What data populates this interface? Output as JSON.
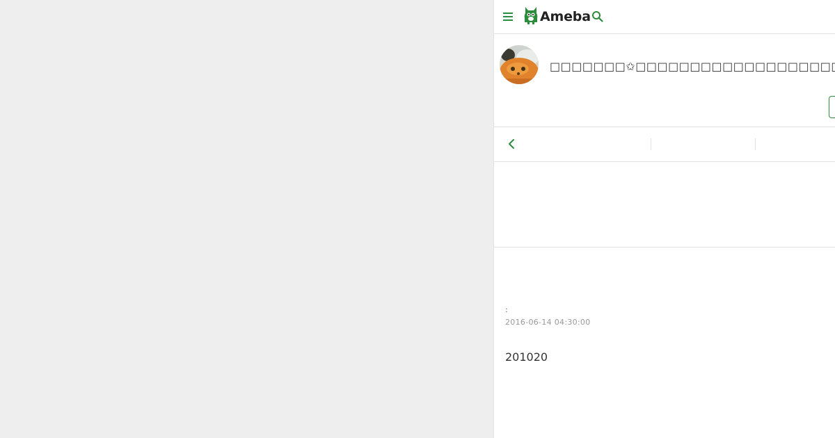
{
  "header": {
    "logo_text": "Ameba",
    "menu_icon": "hamburger-menu-icon",
    "search_icon": "search-icon",
    "accent_color": "#2d8c3c"
  },
  "profile": {
    "blog_title": "□□□□□□□✩□□□□□□□□□□□□□□□□□□□",
    "avatar": "avatar-photo"
  },
  "pager": {
    "prev_icon": "chevron-left-icon"
  },
  "article": {
    "theme_line": ":",
    "date": "2016-06-14 04:30:00",
    "body": "201020"
  }
}
